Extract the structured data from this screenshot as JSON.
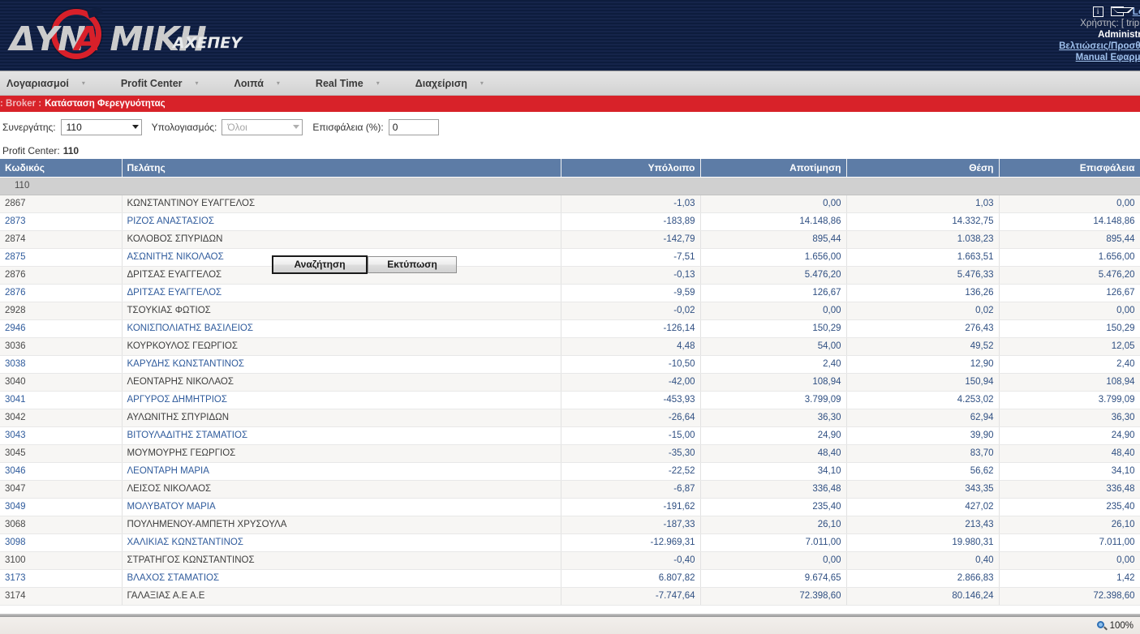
{
  "header": {
    "logo": {
      "main_left": "ΔΥΝ",
      "main_a": "Α",
      "main_right": "ΜΙΚΗ",
      "sub": "ΑΧΕΠΕΥ"
    },
    "info_icon": "i",
    "logout_label": "Logo",
    "user_line": "Χρήστης: [ tripho",
    "role_line": "Administrat",
    "link_improvements": "Βελτιώσεις/Προσθήκ",
    "link_manual": "Manual Εφαρμογ"
  },
  "nav": {
    "items": [
      {
        "label": "Λογαριασμοί"
      },
      {
        "label": "Profit Center"
      },
      {
        "label": "Λοιπά"
      },
      {
        "label": "Real Time"
      },
      {
        "label": "Διαχείριση"
      }
    ],
    "caret": "▾"
  },
  "breadcrumb": {
    "prefix": ": Broker :",
    "title": "Κατάσταση Φερεγγυότητας"
  },
  "filters": {
    "partner_label": "Συνεργάτης:",
    "partner_value": "110",
    "calc_label": "Υπολογιασμός:",
    "calc_value": "Όλοι",
    "risk_label": "Επισφάλεια (%):",
    "risk_value": "0",
    "profit_center_label": "Profit Center:",
    "profit_center_value": "110",
    "search_button": "Αναζήτηση",
    "print_button": "Εκτύπωση"
  },
  "table": {
    "columns": [
      {
        "label": "Κωδικός",
        "align": "left"
      },
      {
        "label": "Πελάτης",
        "align": "left"
      },
      {
        "label": "Υπόλοιπο",
        "align": "right"
      },
      {
        "label": "Αποτίμηση",
        "align": "right"
      },
      {
        "label": "Θέση",
        "align": "right"
      },
      {
        "label": "Επισφάλεια",
        "align": "right"
      }
    ],
    "group_row": "110",
    "rows": [
      {
        "code": "2867",
        "name": "ΚΩΝΣΤΑΝΤΙΝΟΥ ΕΥΑΓΓΕΛΟΣ",
        "link": false,
        "balance": "-1,03",
        "valuation": "0,00",
        "position": "1,03",
        "risk": "0,00"
      },
      {
        "code": "2873",
        "name": "ΡΙΖΟΣ ΑΝΑΣΤΑΣΙΟΣ",
        "link": true,
        "balance": "-183,89",
        "valuation": "14.148,86",
        "position": "14.332,75",
        "risk": "14.148,86"
      },
      {
        "code": "2874",
        "name": "ΚΟΛΟΒΟΣ ΣΠΥΡΙΔΩΝ",
        "link": false,
        "balance": "-142,79",
        "valuation": "895,44",
        "position": "1.038,23",
        "risk": "895,44"
      },
      {
        "code": "2875",
        "name": "ΑΣΩΝΙΤΗΣ ΝΙΚΟΛΑΟΣ",
        "link": true,
        "balance": "-7,51",
        "valuation": "1.656,00",
        "position": "1.663,51",
        "risk": "1.656,00"
      },
      {
        "code": "2876",
        "name": "ΔΡΙΤΣΑΣ ΕΥΑΓΓΕΛΟΣ",
        "link": false,
        "balance": "-0,13",
        "valuation": "5.476,20",
        "position": "5.476,33",
        "risk": "5.476,20"
      },
      {
        "code": "2876",
        "name": "ΔΡΙΤΣΑΣ ΕΥΑΓΓΕΛΟΣ",
        "link": true,
        "balance": "-9,59",
        "valuation": "126,67",
        "position": "136,26",
        "risk": "126,67"
      },
      {
        "code": "2928",
        "name": "ΤΣΟΥΚΙΑΣ ΦΩΤΙΟΣ",
        "link": false,
        "balance": "-0,02",
        "valuation": "0,00",
        "position": "0,02",
        "risk": "0,00"
      },
      {
        "code": "2946",
        "name": "ΚΟΝΙΣΠΟΛΙΑΤΗΣ ΒΑΣΙΛΕΙΟΣ",
        "link": true,
        "balance": "-126,14",
        "valuation": "150,29",
        "position": "276,43",
        "risk": "150,29"
      },
      {
        "code": "3036",
        "name": "ΚΟΥΡΚΟΥΛΟΣ ΓΕΩΡΓΙΟΣ",
        "link": false,
        "balance": "4,48",
        "valuation": "54,00",
        "position": "49,52",
        "risk": "12,05"
      },
      {
        "code": "3038",
        "name": "ΚΑΡΥΔΗΣ ΚΩΝΣΤΑΝΤΙΝΟΣ",
        "link": true,
        "balance": "-10,50",
        "valuation": "2,40",
        "position": "12,90",
        "risk": "2,40"
      },
      {
        "code": "3040",
        "name": "ΛΕΟΝΤΑΡΗΣ ΝΙΚΟΛΑΟΣ",
        "link": false,
        "balance": "-42,00",
        "valuation": "108,94",
        "position": "150,94",
        "risk": "108,94"
      },
      {
        "code": "3041",
        "name": "ΑΡΓΥΡΟΣ ΔΗΜΗΤΡΙΟΣ",
        "link": true,
        "balance": "-453,93",
        "valuation": "3.799,09",
        "position": "4.253,02",
        "risk": "3.799,09"
      },
      {
        "code": "3042",
        "name": "ΑΥΛΩΝΙΤΗΣ ΣΠΥΡΙΔΩΝ",
        "link": false,
        "balance": "-26,64",
        "valuation": "36,30",
        "position": "62,94",
        "risk": "36,30"
      },
      {
        "code": "3043",
        "name": "ΒΙΤΟΥΛΑΔΙΤΗΣ ΣΤΑΜΑΤΙΟΣ",
        "link": true,
        "balance": "-15,00",
        "valuation": "24,90",
        "position": "39,90",
        "risk": "24,90"
      },
      {
        "code": "3045",
        "name": "ΜΟΥΜΟΥΡΗΣ ΓΕΩΡΓΙΟΣ",
        "link": false,
        "balance": "-35,30",
        "valuation": "48,40",
        "position": "83,70",
        "risk": "48,40"
      },
      {
        "code": "3046",
        "name": "ΛΕΟΝΤΑΡΗ ΜΑΡΙΑ",
        "link": true,
        "balance": "-22,52",
        "valuation": "34,10",
        "position": "56,62",
        "risk": "34,10"
      },
      {
        "code": "3047",
        "name": "ΛΕΙΣΟΣ ΝΙΚΟΛΑΟΣ",
        "link": false,
        "balance": "-6,87",
        "valuation": "336,48",
        "position": "343,35",
        "risk": "336,48"
      },
      {
        "code": "3049",
        "name": "ΜΟΛΥΒΑΤΟΥ ΜΑΡΙΑ",
        "link": true,
        "balance": "-191,62",
        "valuation": "235,40",
        "position": "427,02",
        "risk": "235,40"
      },
      {
        "code": "3068",
        "name": "ΠΟΥΛΗΜΕΝΟΥ-ΑΜΠΕΤΗ ΧΡΥΣΟΥΛΑ",
        "link": false,
        "balance": "-187,33",
        "valuation": "26,10",
        "position": "213,43",
        "risk": "26,10"
      },
      {
        "code": "3098",
        "name": "ΧΑΛΙΚΙΑΣ ΚΩΝΣΤΑΝΤΙΝΟΣ",
        "link": true,
        "balance": "-12.969,31",
        "valuation": "7.011,00",
        "position": "19.980,31",
        "risk": "7.011,00"
      },
      {
        "code": "3100",
        "name": "ΣΤΡΑΤΗΓΟΣ ΚΩΝΣΤΑΝΤΙΝΟΣ",
        "link": false,
        "balance": "-0,40",
        "valuation": "0,00",
        "position": "0,40",
        "risk": "0,00"
      },
      {
        "code": "3173",
        "name": "ΒΛΑΧΟΣ ΣΤΑΜΑΤΙΟΣ",
        "link": true,
        "balance": "6.807,82",
        "valuation": "9.674,65",
        "position": "2.866,83",
        "risk": "1,42"
      },
      {
        "code": "3174",
        "name": "ΓΑΛΑΞΙΑΣ Α.Ε Α.Ε",
        "link": false,
        "balance": "-7.747,64",
        "valuation": "72.398,60",
        "position": "80.146,24",
        "risk": "72.398,60"
      }
    ]
  },
  "statusbar": {
    "zoom_level": "100%"
  },
  "colors": {
    "brand_red": "#d82229",
    "header_navy": "#0d1c3d",
    "table_header": "#5d7ca6",
    "link_blue": "#2f5b9c"
  }
}
